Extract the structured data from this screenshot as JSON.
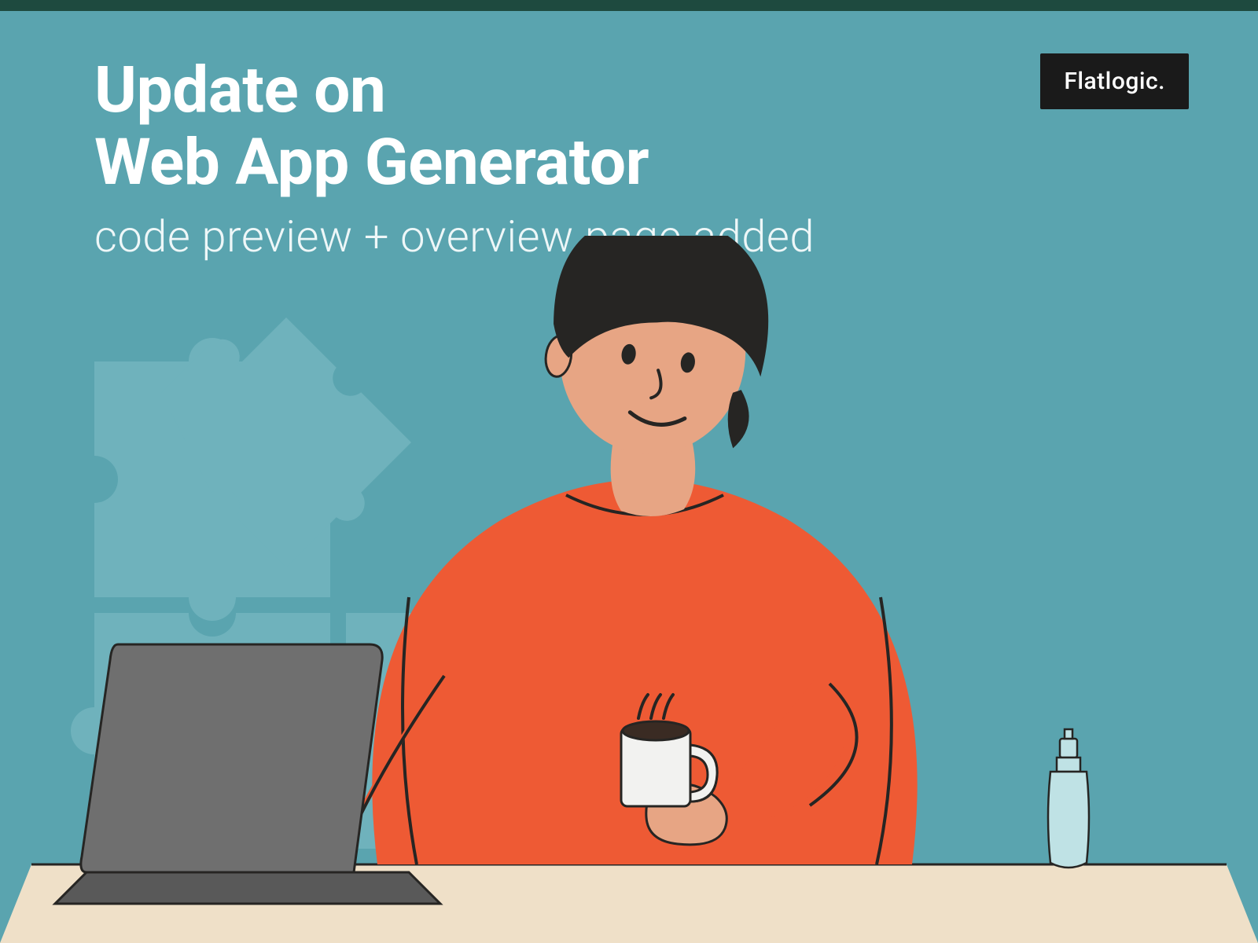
{
  "heading": {
    "title_line1": "Update on",
    "title_line2": "Web App Generator",
    "subtitle": "code preview + overview page added"
  },
  "brand": {
    "label": "Flatlogic."
  },
  "palette": {
    "bg": "#5aa4af",
    "accent_dark_green": "#1e4a3f",
    "sweater": "#ee5a34",
    "skin": "#e7a584",
    "hair": "#262523",
    "desk": "#efe0c8",
    "laptop": "#6f6f6f",
    "laptop_dark": "#595959",
    "mug": "#f2f2f0",
    "coffee": "#3a2b23",
    "line": "#262523",
    "puzzle": "#6fb2bc",
    "bottle": "#bfe2e5"
  },
  "icons": {
    "puzzle": "puzzle-pieces-icon",
    "person": "person-at-laptop-icon",
    "laptop": "laptop-icon",
    "mug": "coffee-mug-icon",
    "bottle": "spray-bottle-icon"
  }
}
